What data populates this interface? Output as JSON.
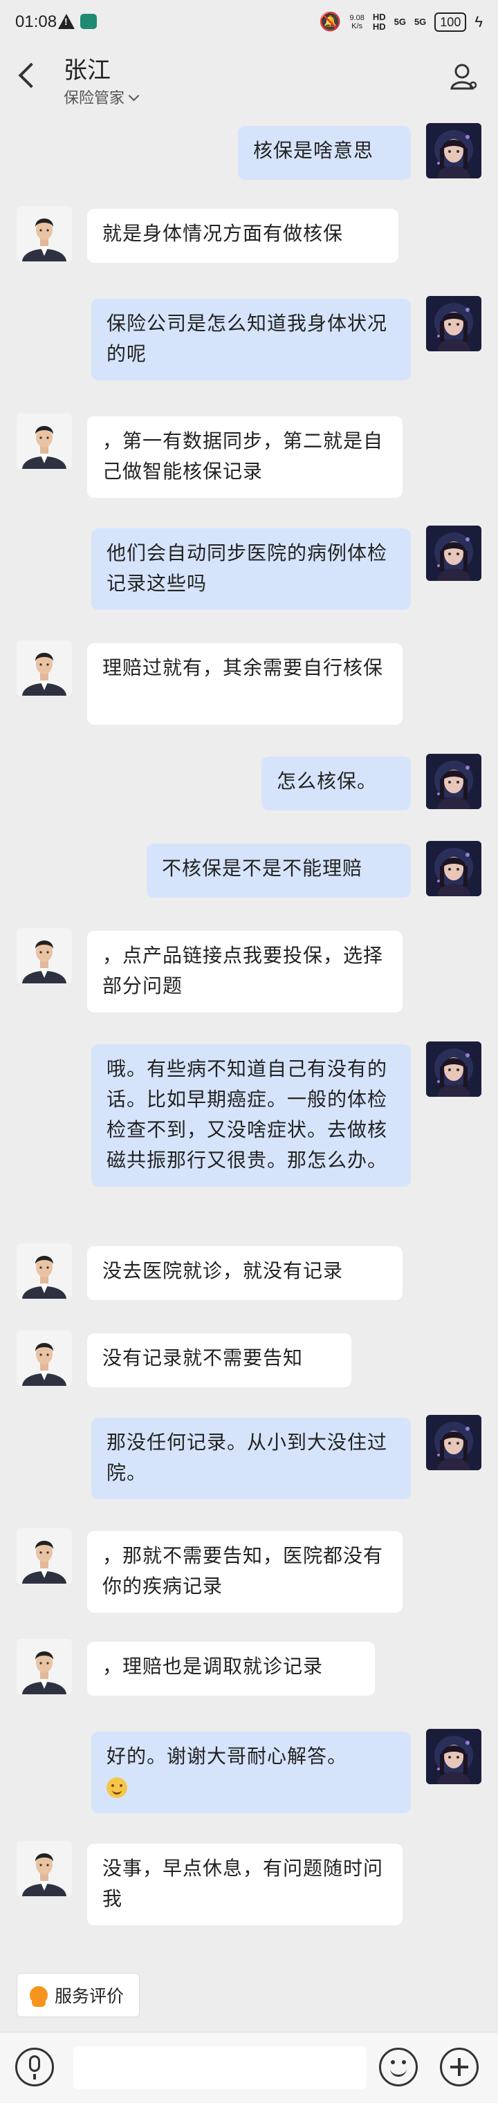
{
  "status_bar": {
    "time": "01:08",
    "speed_top": "9.08",
    "speed_bottom": "K/s",
    "sig1_top": "HD",
    "sig1_mid": "HD",
    "sig2": "5G",
    "sig3": "5G",
    "battery": "100"
  },
  "header": {
    "title": "张江",
    "subtitle": "保险管家"
  },
  "messages": [
    {
      "side": "right",
      "text": "核保是啥意思"
    },
    {
      "side": "left",
      "text": "就是身体情况方面有做核保"
    },
    {
      "side": "right",
      "text": "保险公司是怎么知道我身体状况的呢"
    },
    {
      "side": "left",
      "text": "，第一有数据同步，第二就是自己做智能核保记录"
    },
    {
      "side": "right",
      "text": "他们会自动同步医院的病例体检记录这些吗"
    },
    {
      "side": "left",
      "text": "理赔过就有，其余需要自行核保"
    },
    {
      "side": "right",
      "text": "怎么核保。"
    },
    {
      "side": "right",
      "text": "不核保是不是不能理赔"
    },
    {
      "side": "left",
      "text": "，点产品链接点我要投保，选择部分问题"
    },
    {
      "side": "right",
      "text": "哦。有些病不知道自己有没有的话。比如早期癌症。一般的体检检查不到，又没啥症状。去做核磁共振那行又很贵。那怎么办。"
    },
    {
      "side": "left",
      "text": "没去医院就诊，就没有记录"
    },
    {
      "side": "left",
      "text": "没有记录就不需要告知"
    },
    {
      "side": "right",
      "text": "那没任何记录。从小到大没住过院。"
    },
    {
      "side": "left",
      "text": "，那就不需要告知，医院都没有你的疾病记录"
    },
    {
      "side": "left",
      "text": "，理赔也是调取就诊记录"
    },
    {
      "side": "right",
      "text": "好的。谢谢大哥耐心解答。",
      "emoji": "smiling-face"
    },
    {
      "side": "left",
      "text": "没事，早点休息，有问题随时问我"
    }
  ],
  "service_button": "服务评价",
  "input": {
    "placeholder": ""
  }
}
